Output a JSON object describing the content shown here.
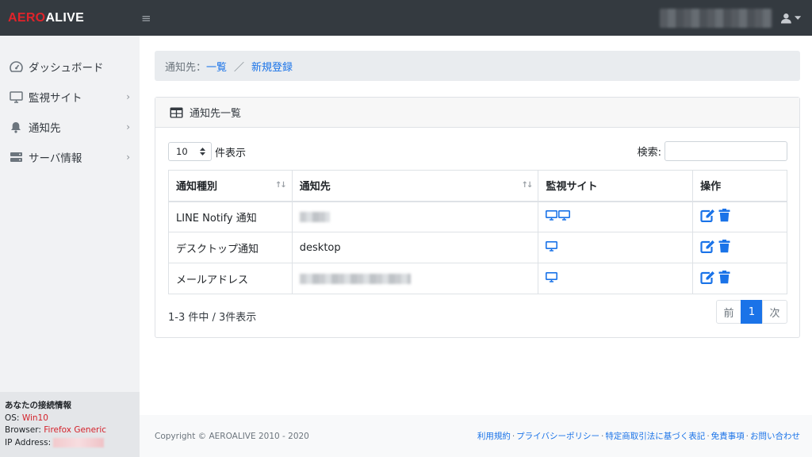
{
  "brand": {
    "part1": "AERO",
    "part2": "ALIVE"
  },
  "sidebar": {
    "items": [
      {
        "label": "ダッシュボード"
      },
      {
        "label": "監視サイト"
      },
      {
        "label": "通知先"
      },
      {
        "label": "サーバ情報"
      }
    ],
    "conn": {
      "title": "あなたの接続情報",
      "os_label": "OS: ",
      "os_value": "Win10",
      "browser_label": "Browser: ",
      "browser_value": "Firefox Generic",
      "ip_label": "IP Address: "
    }
  },
  "breadcrumb": {
    "prefix": "通知先：",
    "list": "一覧",
    "sep": "／",
    "new": "新規登録"
  },
  "card": {
    "title": "通知先一覧"
  },
  "table_controls": {
    "length_value": "10",
    "length_suffix": "件表示",
    "search_label": "検索:"
  },
  "table": {
    "headers": [
      "通知種別",
      "通知先",
      "監視サイト",
      "操作"
    ],
    "rows": [
      {
        "type": "LINE Notify 通知",
        "dest": ""
      },
      {
        "type": "デスクトップ通知",
        "dest": "desktop"
      },
      {
        "type": "メールアドレス",
        "dest": ""
      }
    ]
  },
  "table_info": "1-3 件中 / 3件表示",
  "pagination": {
    "prev": "前",
    "current": "1",
    "next": "次"
  },
  "footer": {
    "copyright": "Copyright © AEROALIVE 2010 - 2020",
    "links": [
      "利用規約",
      "プライバシーポリシー",
      "特定商取引法に基づく表記",
      "免責事項",
      "お問い合わせ"
    ]
  },
  "colors": {
    "accent": "#1a73e8",
    "brand_red": "#e0232a",
    "topbar": "#343a40"
  }
}
